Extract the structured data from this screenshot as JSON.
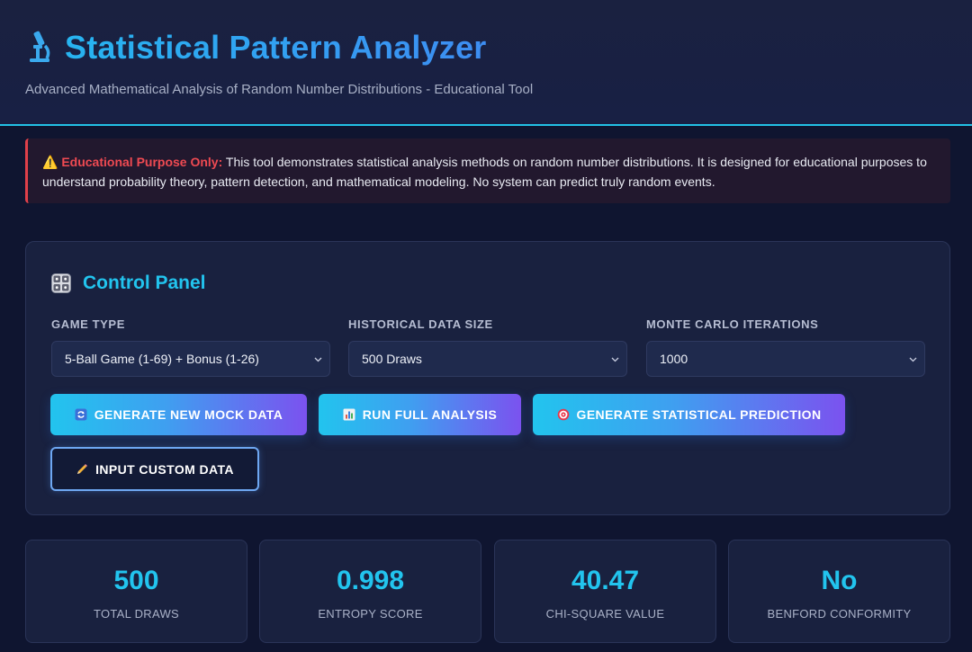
{
  "header": {
    "title": "Statistical Pattern Analyzer",
    "title_icon": "microscope-icon",
    "subtitle": "Advanced Mathematical Analysis of Random Number Distributions - Educational Tool"
  },
  "warning": {
    "icon": "warning-icon",
    "label": "Educational Purpose Only:",
    "text": "This tool demonstrates statistical analysis methods on random number distributions. It is designed for educational purposes to understand probability theory, pattern detection, and mathematical modeling. No system can predict truly random events."
  },
  "control_panel": {
    "icon": "dice-icon",
    "title": "Control Panel",
    "fields": [
      {
        "label": "GAME TYPE",
        "value": "5-Ball Game (1-69) + Bonus (1-26)"
      },
      {
        "label": "HISTORICAL DATA SIZE",
        "value": "500 Draws"
      },
      {
        "label": "MONTE CARLO ITERATIONS",
        "value": "1000"
      }
    ],
    "buttons": {
      "generate_mock": "GENERATE NEW MOCK DATA",
      "run_analysis": "RUN FULL ANALYSIS",
      "generate_prediction": "GENERATE STATISTICAL PREDICTION",
      "input_custom": "INPUT CUSTOM DATA"
    }
  },
  "stats": [
    {
      "value": "500",
      "label": "TOTAL DRAWS"
    },
    {
      "value": "0.998",
      "label": "ENTROPY SCORE"
    },
    {
      "value": "40.47",
      "label": "CHI-SQUARE VALUE"
    },
    {
      "value": "No",
      "label": "BENFORD CONFORMITY"
    }
  ],
  "colors": {
    "accent_cyan": "#22c4ee",
    "accent_blue": "#2ea3f2",
    "accent_purple": "#7b52ef",
    "warning_red": "#ef4a52",
    "background": "#0f1530"
  }
}
